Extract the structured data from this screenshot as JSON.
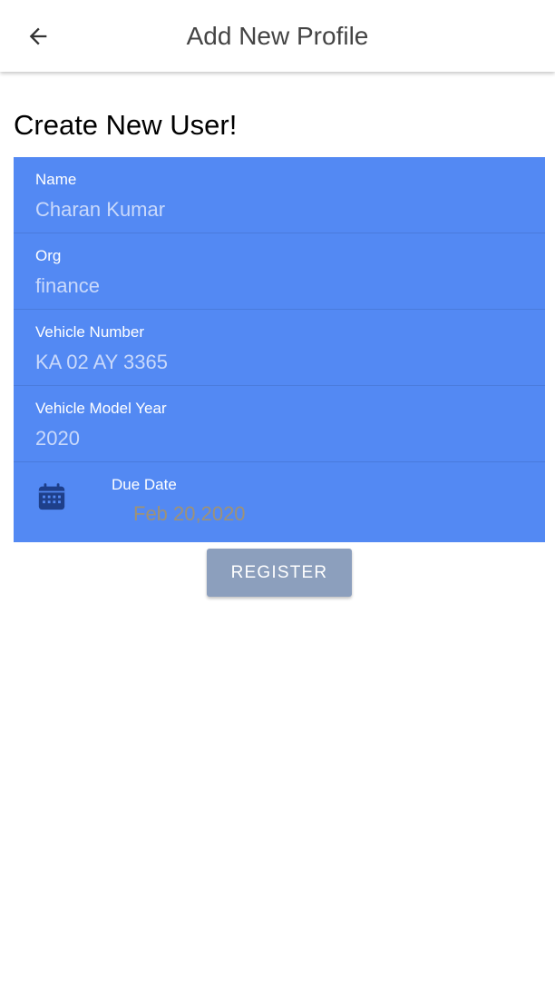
{
  "app_bar": {
    "title": "Add New Profile",
    "back_icon": "arrow-left-icon"
  },
  "heading": "Create New User!",
  "form": {
    "fields": [
      {
        "label": "Name",
        "value": "Charan Kumar"
      },
      {
        "label": "Org",
        "value": "finance"
      },
      {
        "label": "Vehicle Number",
        "value": "KA 02 AY 3365"
      },
      {
        "label": "Vehicle Model Year",
        "value": "2020"
      }
    ],
    "due_date": {
      "icon": "calendar-icon",
      "label": "Due Date",
      "value": "Feb 20,2020"
    }
  },
  "register_label": "REGISTER",
  "colors": {
    "form_background": "#5389f3",
    "button_background": "#8c9fbd",
    "calendar_icon": "#1e3f8a"
  }
}
